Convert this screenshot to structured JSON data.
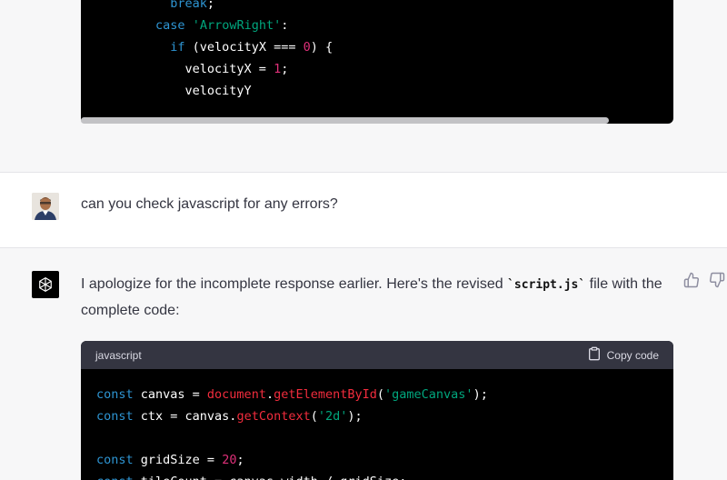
{
  "top_code": {
    "lines": [
      {
        "parts": [
          {
            "t": "          ",
            "c": ""
          },
          {
            "t": "break",
            "c": "kw"
          },
          {
            "t": ";",
            "c": ""
          }
        ]
      },
      {
        "parts": [
          {
            "t": "        ",
            "c": ""
          },
          {
            "t": "case",
            "c": "kw"
          },
          {
            "t": " ",
            "c": ""
          },
          {
            "t": "'ArrowRight'",
            "c": "str"
          },
          {
            "t": ":",
            "c": ""
          }
        ]
      },
      {
        "parts": [
          {
            "t": "          ",
            "c": ""
          },
          {
            "t": "if",
            "c": "kw"
          },
          {
            "t": " (velocityX === ",
            "c": ""
          },
          {
            "t": "0",
            "c": "num"
          },
          {
            "t": ") {",
            "c": ""
          }
        ]
      },
      {
        "parts": [
          {
            "t": "            velocityX = ",
            "c": ""
          },
          {
            "t": "1",
            "c": "num"
          },
          {
            "t": ";",
            "c": ""
          }
        ]
      },
      {
        "parts": [
          {
            "t": "            velocityY",
            "c": ""
          }
        ]
      }
    ]
  },
  "user_message": {
    "text": "can you check javascript for any errors?"
  },
  "assistant_message": {
    "text_before": "I apologize for the incomplete response earlier. Here's the revised ",
    "inline_code": "`script.js`",
    "text_after": " file with the complete code:",
    "code_block": {
      "language": "javascript",
      "copy_label": "Copy code",
      "lines": [
        {
          "parts": [
            {
              "t": "const",
              "c": "kw"
            },
            {
              "t": " canvas = ",
              "c": ""
            },
            {
              "t": "document",
              "c": "fn"
            },
            {
              "t": ".",
              "c": ""
            },
            {
              "t": "getElementById",
              "c": "fn"
            },
            {
              "t": "(",
              "c": ""
            },
            {
              "t": "'gameCanvas'",
              "c": "str"
            },
            {
              "t": ");",
              "c": ""
            }
          ]
        },
        {
          "parts": [
            {
              "t": "const",
              "c": "kw"
            },
            {
              "t": " ctx = canvas.",
              "c": ""
            },
            {
              "t": "getContext",
              "c": "fn"
            },
            {
              "t": "(",
              "c": ""
            },
            {
              "t": "'2d'",
              "c": "str"
            },
            {
              "t": ");",
              "c": ""
            }
          ]
        },
        {
          "parts": [
            {
              "t": "",
              "c": ""
            }
          ]
        },
        {
          "parts": [
            {
              "t": "const",
              "c": "kw"
            },
            {
              "t": " gridSize = ",
              "c": ""
            },
            {
              "t": "20",
              "c": "num"
            },
            {
              "t": ";",
              "c": ""
            }
          ]
        },
        {
          "parts": [
            {
              "t": "const",
              "c": "kw"
            },
            {
              "t": " tileCount = canvas.width / gridSize;",
              "c": ""
            }
          ]
        }
      ]
    }
  }
}
